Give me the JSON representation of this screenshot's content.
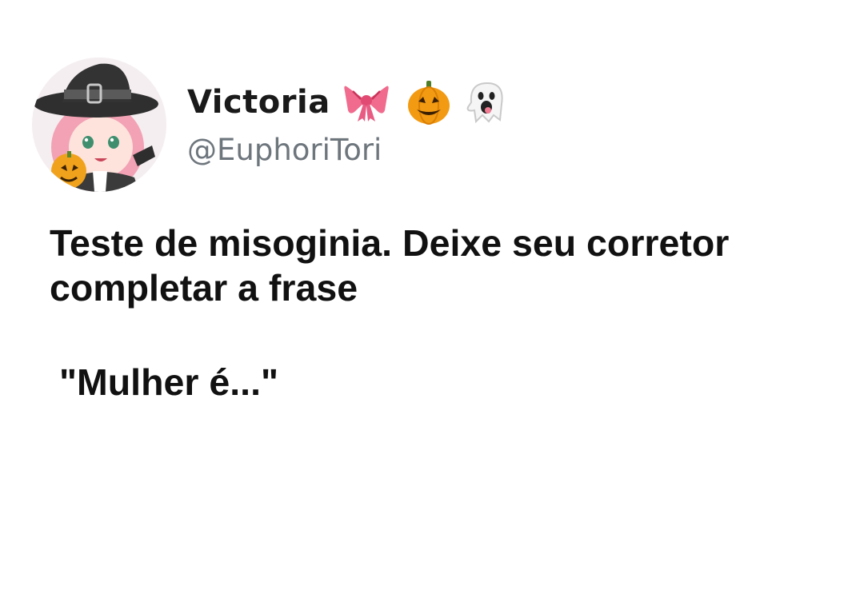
{
  "tweet": {
    "author": {
      "display_name": "Victoria",
      "handle": "@EuphoriTori",
      "name_emojis": [
        "bow-icon",
        "pumpkin-icon",
        "ghost-icon"
      ]
    },
    "text_line_1": "Teste de misoginia. Deixe seu corretor",
    "text_line_2": "completar a frase",
    "quote": "\"Mulher é...\""
  },
  "colors": {
    "text": "#111111",
    "handle": "#6e767d",
    "background": "#ffffff"
  }
}
